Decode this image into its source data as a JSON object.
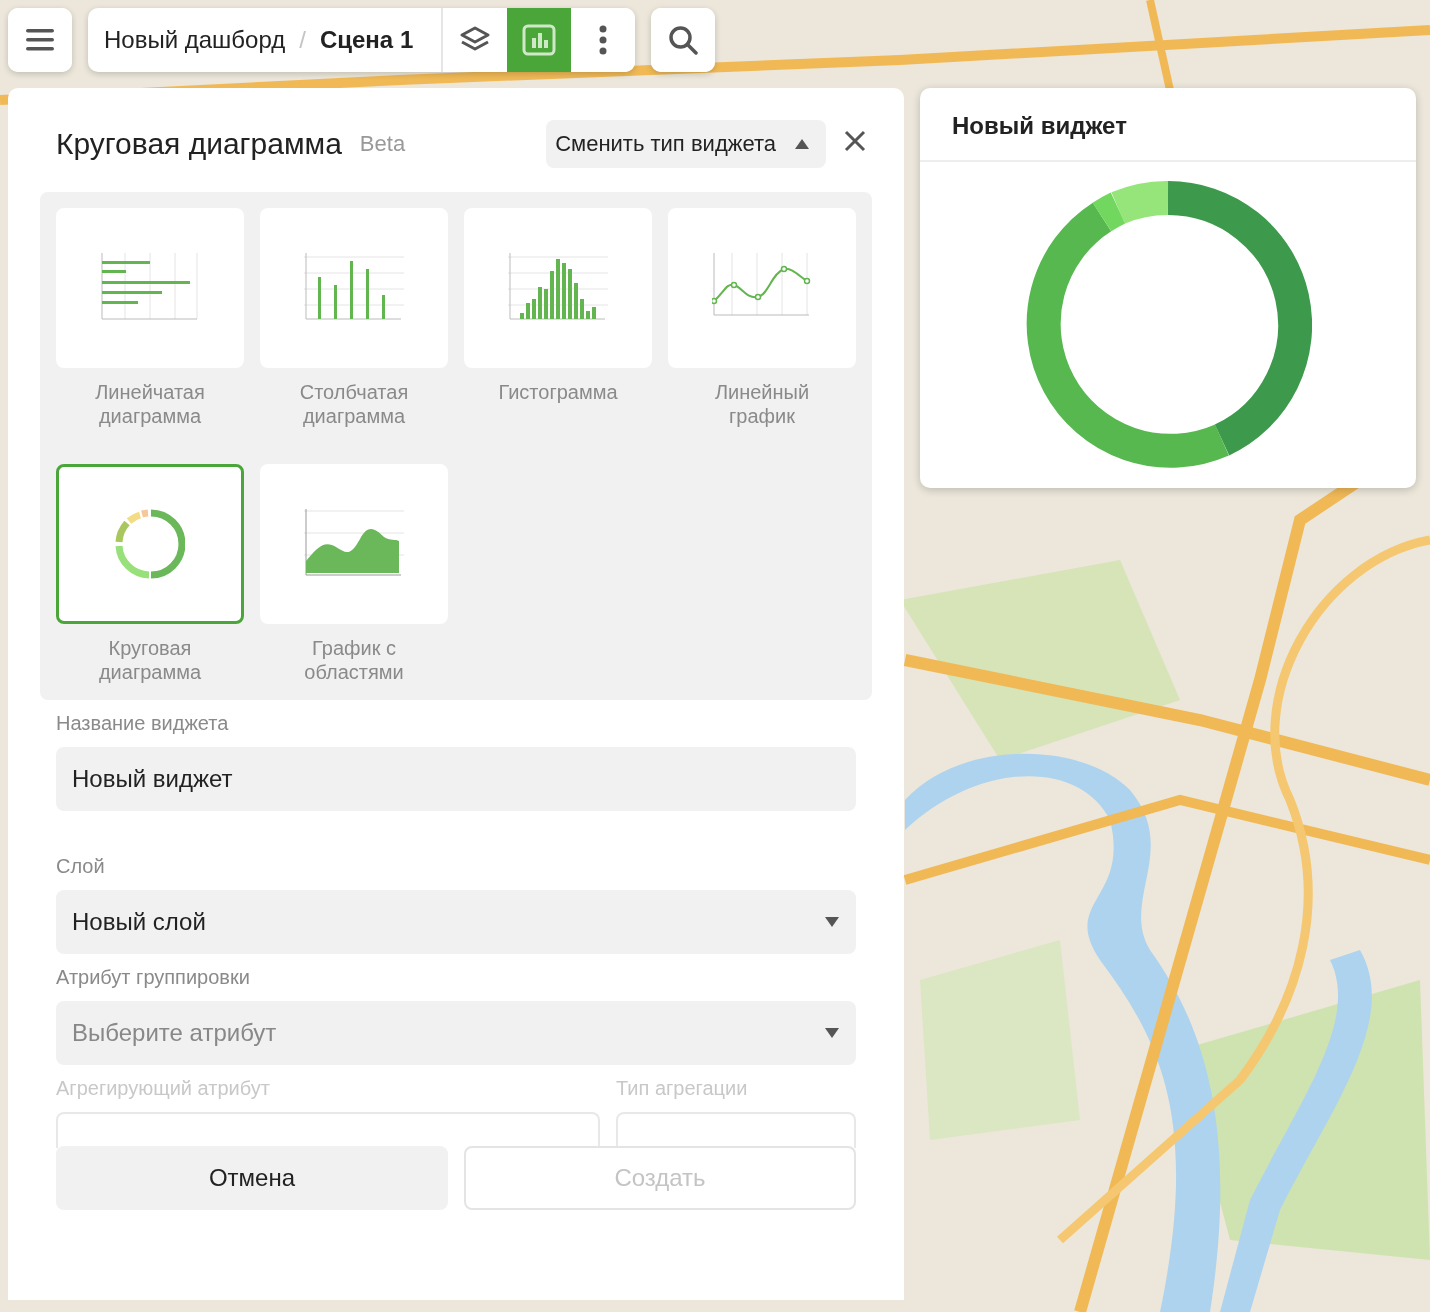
{
  "toolbar": {
    "breadcrumb": {
      "dashboard": "Новый дашборд",
      "separator": "/",
      "scene": "Сцена 1"
    },
    "tools": [
      {
        "kind": "layers",
        "selected": false
      },
      {
        "kind": "chart",
        "selected": true
      },
      {
        "kind": "more",
        "selected": false
      }
    ]
  },
  "panel": {
    "title": "Круговая диаграмма",
    "badge": "Beta",
    "change_type_button": "Сменить тип виджета",
    "expanded": true,
    "types": [
      {
        "kind": "bar_h",
        "label": "Линейчатая диаграмма",
        "selected": false
      },
      {
        "kind": "bar_v",
        "label": "Столбчатая диаграмма",
        "selected": false
      },
      {
        "kind": "histogram",
        "label": "Гистограмма",
        "selected": false
      },
      {
        "kind": "line",
        "label": "Линейный график",
        "selected": false
      },
      {
        "kind": "donut",
        "label": "Круговая диаграмма",
        "selected": true
      },
      {
        "kind": "area",
        "label": "График с областями",
        "selected": false
      }
    ],
    "fields": [
      {
        "kind": "input",
        "label": "Название виджета",
        "value": "Новый виджет"
      },
      {
        "kind": "select",
        "label": "Слой",
        "value": "Новый слой"
      },
      {
        "kind": "select",
        "label": "Атрибут группировки",
        "placeholder": "Выберите атрибут"
      }
    ],
    "aggregation": [
      {
        "label": "Агрегирующий атрибут",
        "disabled": true
      },
      {
        "label": "Тип агрегации",
        "disabled": true
      }
    ],
    "buttons": [
      {
        "label": "Отмена",
        "disabled": false
      },
      {
        "label": "Создать",
        "disabled": true
      }
    ]
  },
  "widget": {
    "title": "Новый виджет"
  }
}
